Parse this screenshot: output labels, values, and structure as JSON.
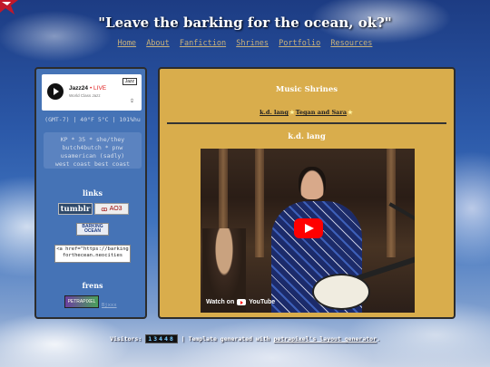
{
  "header": {
    "title": "\"Leave the barking for the ocean, ok?\""
  },
  "nav": [
    {
      "label": "Home"
    },
    {
      "label": "About"
    },
    {
      "label": "Fanfiction"
    },
    {
      "label": "Shrines"
    },
    {
      "label": "Portfolio"
    },
    {
      "label": "Resources"
    }
  ],
  "sidebar": {
    "player": {
      "station": "Jazz24",
      "live": "• LIVE",
      "genre": "World Class Jazz",
      "brand": "Jazz"
    },
    "weather": "(GMT-7) | 40°F 5°C | 101%hu",
    "bio_lines": [
      "KP * 35 * she/they",
      "butch4butch * pnw",
      "usamerican (sadly)",
      "west coast best coast"
    ],
    "links_heading": "links",
    "tumblr_label": "tumblr",
    "ao3_label": "AO3",
    "bto_label_1": "BARKING",
    "bto_label_2": "OCEAN",
    "code_text": "<a href=\"https://barking forthecean.neocities",
    "frens_heading": "frens",
    "fren_button": "PETRAPIXEL",
    "fren_link": "Bjxxx"
  },
  "main": {
    "heading": "Music Shrines",
    "sub_links": [
      {
        "label": "k.d. lang"
      },
      {
        "label": "Tegan and Sara"
      }
    ],
    "section_heading": "k.d. lang",
    "video": {
      "watch_on": "Watch on",
      "platform": "YouTube"
    }
  },
  "footer": {
    "visitors_label": "Visitors:",
    "visitor_count": "13448",
    "separator": "|",
    "template_text": "Template generated with",
    "generator_link": "petrapixel's layout generator",
    "end": "."
  },
  "colors": {
    "sidebar_bg": "#4573b6",
    "main_bg": "#d9ad4c",
    "nav_link": "#c9b27a",
    "youtube_red": "#ff0000"
  }
}
